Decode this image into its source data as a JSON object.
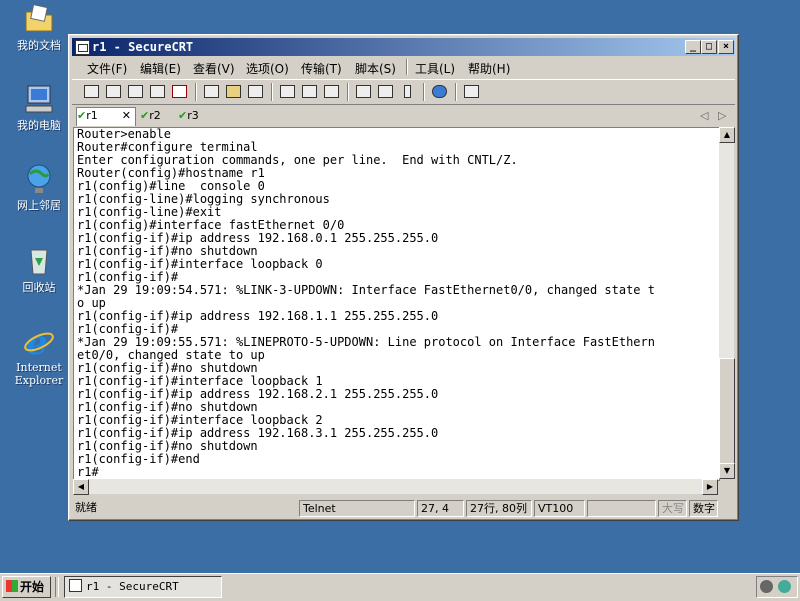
{
  "desktop": {
    "icons": [
      {
        "label": "我的文档"
      },
      {
        "label": "我的电脑"
      },
      {
        "label": "网上邻居"
      },
      {
        "label": "回收站"
      },
      {
        "label": "Internet Explorer"
      }
    ]
  },
  "window": {
    "title": "r1 - SecureCRT",
    "menu": [
      "文件(F)",
      "编辑(E)",
      "查看(V)",
      "选项(O)",
      "传输(T)",
      "脚本(S)",
      "工具(L)",
      "帮助(H)"
    ],
    "tabs": [
      {
        "label": "r1",
        "active": true
      },
      {
        "label": "r2",
        "active": false
      },
      {
        "label": "r3",
        "active": false
      }
    ],
    "terminal_lines": [
      "Router>enable",
      "Router#configure terminal",
      "Enter configuration commands, one per line.  End with CNTL/Z.",
      "Router(config)#hostname r1",
      "r1(config)#line  console 0",
      "r1(config-line)#logging synchronous",
      "r1(config-line)#exit",
      "r1(config)#interface fastEthernet 0/0",
      "r1(config-if)#ip address 192.168.0.1 255.255.255.0",
      "r1(config-if)#no shutdown",
      "r1(config-if)#interface loopback 0",
      "r1(config-if)#",
      "*Jan 29 19:09:54.571: %LINK-3-UPDOWN: Interface FastEthernet0/0, changed state t",
      "o up",
      "r1(config-if)#ip address 192.168.1.1 255.255.255.0",
      "r1(config-if)#",
      "*Jan 29 19:09:55.571: %LINEPROTO-5-UPDOWN: Line protocol on Interface FastEthern",
      "et0/0, changed state to up",
      "r1(config-if)#no shutdown",
      "r1(config-if)#interface loopback 1",
      "r1(config-if)#ip address 192.168.2.1 255.255.255.0",
      "r1(config-if)#no shutdown",
      "r1(config-if)#interface loopback 2",
      "r1(config-if)#ip address 192.168.3.1 255.255.255.0",
      "r1(config-if)#no shutdown",
      "r1(config-if)#end",
      "r1#"
    ],
    "status": {
      "ready": "就绪",
      "protocol": "Telnet",
      "cursor": "27,  4",
      "size": "27行, 80列",
      "emulation": "VT100",
      "caps": "大写",
      "num": "数字"
    }
  },
  "taskbar": {
    "start_label": "开始",
    "task_label": "r1 - SecureCRT"
  }
}
